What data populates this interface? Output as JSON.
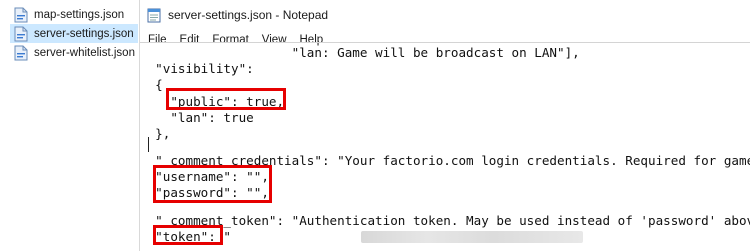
{
  "explorer": {
    "files": [
      {
        "name": "map-settings.json",
        "selected": false,
        "icon": "json-file-icon"
      },
      {
        "name": "server-settings.json",
        "selected": true,
        "icon": "json-file-icon"
      },
      {
        "name": "server-whitelist.json",
        "selected": false,
        "icon": "json-file-icon"
      }
    ]
  },
  "notepad": {
    "title": "server-settings.json - Notepad",
    "icon": "notepad-icon",
    "menu": [
      "File",
      "Edit",
      "Format",
      "View",
      "Help"
    ],
    "lines": [
      "                    \"lan: Game will be broadcast on LAN\"],",
      "  \"visibility\":",
      "  {",
      "    \"public\": true,",
      "    \"lan\": true",
      "  },",
      "",
      "  \"_comment_credentials\": \"Your factorio.com login credentials. Required for games with",
      "  \"username\": \"\",",
      "  \"password\": \"\",",
      "",
      "  \"_comment_token\": \"Authentication token. May be used instead of 'password' above.\",",
      "  \"token\": \""
    ],
    "highlight_color": "#e60000",
    "highlighted_keys": [
      "\"public\": true,",
      "\"username\": \"\", \"password\": \"\",",
      "\"token\":"
    ]
  }
}
